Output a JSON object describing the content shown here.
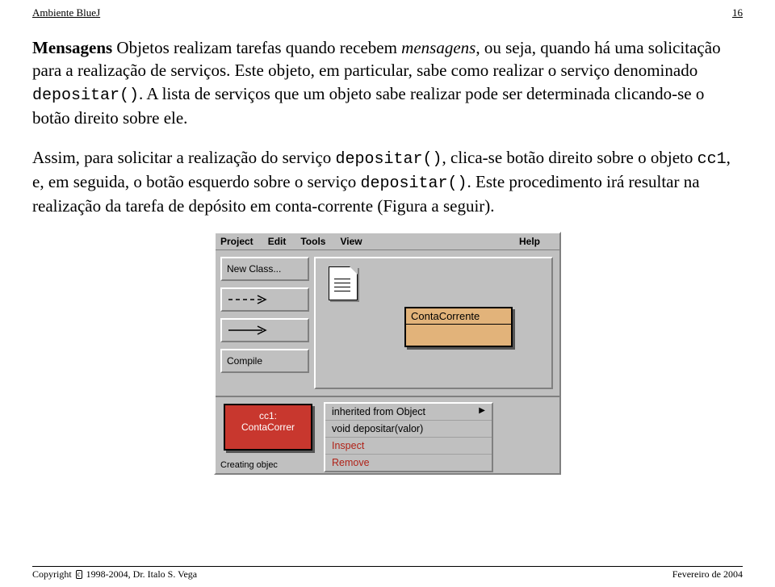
{
  "header": {
    "left": "Ambiente BlueJ",
    "right": "16"
  },
  "section_title": "Mensagens",
  "para1": {
    "lead_after_title": " Objetos realizam tarefas quando recebem ",
    "italic1": "mensagens",
    "cont1": ", ou seja, quando há uma solicitação para a realização de serviços. Este objeto, em particular, sabe como realizar o serviço denominado ",
    "code1": "depositar()",
    "cont2": ". A lista de serviços que um objeto sabe realizar pode ser determinada clicando-se o botão direito sobre ele."
  },
  "para2": {
    "t1": "Assim, para solicitar a realização do serviço ",
    "code1": "depositar()",
    "t2": ", clica-se botão direito sobre o objeto ",
    "code2": "cc1",
    "t3": ", e, em seguida, o botão esquerdo sobre o serviço ",
    "code3": "depositar()",
    "t4": ". Este procedimento irá resultar na realização da tarefa de depósito em conta-corrente (Figura a seguir)."
  },
  "bluej": {
    "menu": {
      "project": "Project",
      "edit": "Edit",
      "tools": "Tools",
      "view": "View",
      "help": "Help"
    },
    "buttons": {
      "new_class": "New Class...",
      "dashed_arrow": "- - - >",
      "compile": "Compile"
    },
    "class_name": "ContaCorrente",
    "object": {
      "name": "cc1:",
      "type": "ContaCorrer"
    },
    "context_menu": {
      "inherited": "inherited from Object",
      "method": "void depositar(valor)",
      "inspect": "Inspect",
      "remove": "Remove"
    },
    "status": "Creating objec"
  },
  "footer": {
    "copyright_prefix": "Copyright ",
    "copyright_symbol": "c",
    "copyright_rest": " 1998-2004, Dr. Italo S. Vega",
    "date": "Fevereiro de 2004"
  }
}
